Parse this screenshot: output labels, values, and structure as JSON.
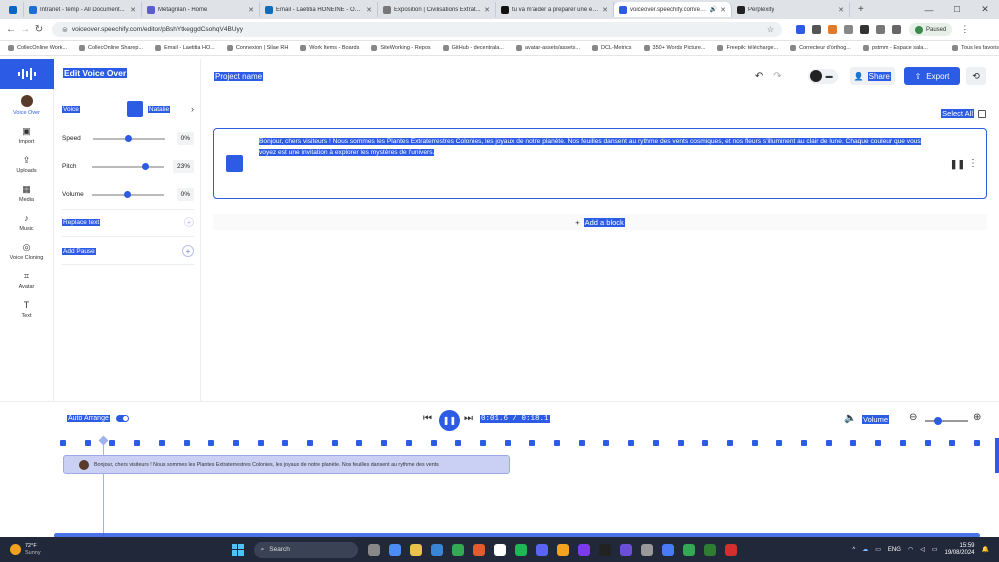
{
  "browser": {
    "tabs": [
      {
        "label": "Intranet - temp - All Document...",
        "color": "#1f6fd1",
        "active": false
      },
      {
        "label": "Metagrilan - Home",
        "color": "#5b5bd6",
        "active": false
      },
      {
        "label": "Email - Laetitia HONEINE - Outl...",
        "color": "#0f6cbd",
        "active": false
      },
      {
        "label": "Exposition | Civilisations Extrat...",
        "color": "#777777",
        "active": false
      },
      {
        "label": "tu va m'aider a preparer une ex...",
        "color": "#111111",
        "active": false
      },
      {
        "label": "voiceover.speechify.com/ec...",
        "color": "#2c5be5",
        "active": true
      },
      {
        "label": "Perplexity",
        "color": "#222222",
        "active": false
      }
    ],
    "url": "voiceover.speechify.com/editor/pBshYtkeggdCsohqV4BUyy",
    "paused_label": "Paused",
    "bookmarks": [
      "CollecOnline Work...",
      "CollecOnline Sharep...",
      "Email - Laetitia HO...",
      "Connexion | Silae RH",
      "Work Items - Boards",
      "SiteWorking - Repos",
      "GitHub - decentrala...",
      "avatar-assets/assets...",
      "DCL-Metrics",
      "350+ Words Picture...",
      "Freepik: télécharge...",
      "Correcteur d'orthog...",
      "pstmm - Espace sala...",
      "Tous les favoris"
    ]
  },
  "rail": {
    "items": [
      {
        "label": "Voice Over",
        "icon": "avatar-icon"
      },
      {
        "label": "Import",
        "icon": "import-icon"
      },
      {
        "label": "Uploads",
        "icon": "upload-icon"
      },
      {
        "label": "Media",
        "icon": "media-icon"
      },
      {
        "label": "Music",
        "icon": "music-icon"
      },
      {
        "label": "Voice Cloning",
        "icon": "voice-cloning-icon"
      },
      {
        "label": "Avatar",
        "icon": "avatar-scan-icon"
      },
      {
        "label": "Text",
        "icon": "text-icon"
      }
    ]
  },
  "panel": {
    "title": "Edit Voice Over",
    "voice_label": "Voice",
    "voice_name": "Natalie",
    "speed": {
      "label": "Speed",
      "value": "0%",
      "level": 0.5
    },
    "pitch": {
      "label": "Pitch",
      "value": "23%",
      "level": 0.73
    },
    "volume": {
      "label": "Volume",
      "value": "0%",
      "level": 0.5
    },
    "replace_text": "Replace text",
    "add_pause": "Add Pause"
  },
  "header": {
    "project_name": "Project name",
    "share": "Share",
    "export": "Export"
  },
  "main": {
    "select_all": "Select All",
    "block_text": "Bonjour, chers visiteurs ! Nous sommes les Plantes Extraterrestres Colonies, les joyaux de notre planète. Nos feuilles dansent au rythme des vents cosmiques, et nos fleurs s'illuminent au clair de lune. Chaque couleur que vous voyez est une invitation à explorer les mystères de l'univers.",
    "add_block": "Add a block"
  },
  "player": {
    "auto_arrange": "Auto Arrange",
    "time": "0:01.6 / 0:18.1",
    "volume": "Volume",
    "timeline_clip": "Bonjour, chers visiteurs ! Nous sommes les Plantes Extraterrestres Colonies, les joyaux de notre planète. Nos feuilles dansent au rythme des vents",
    "zoom_level": 0.3
  },
  "taskbar": {
    "weather_temp": "72°F",
    "weather_desc": "Sunny",
    "search": "Search",
    "lang": "ENG",
    "time": "15:59",
    "date": "19/08/2024"
  },
  "colors": {
    "accent": "#2c5be5",
    "taskbar": "#20283a"
  }
}
